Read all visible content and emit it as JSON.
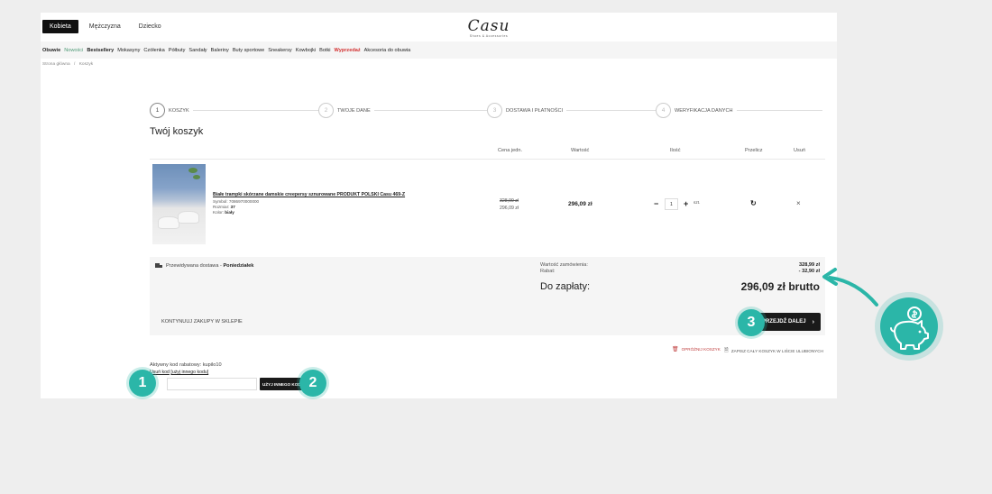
{
  "header": {
    "gender_tabs": [
      "Kobieta",
      "Mężczyzna",
      "Dziecko"
    ],
    "logo": "Casu",
    "logo_sub": "Shoes & Accessories"
  },
  "menu": [
    "Obuwie",
    "Nowości",
    "Bestsellery",
    "Mokasyny",
    "Czółenka",
    "Półbuty",
    "Sandały",
    "Baleriny",
    "Buty sportowe",
    "Sneakersy",
    "Kowbojki",
    "Botki",
    "Wyprzedaż",
    "Akcesoria do obuwia"
  ],
  "breadcrumb": [
    "Strona główna",
    "/",
    "Koszyk"
  ],
  "steps": [
    {
      "num": "1",
      "label": "Koszyk"
    },
    {
      "num": "2",
      "label": "Twoje dane"
    },
    {
      "num": "3",
      "label": "Dostawa i płatności"
    },
    {
      "num": "4",
      "label": "Weryfikacja danych"
    }
  ],
  "cart_title": "Twój koszyk",
  "table_headers": {
    "unit_price": "Cena jedn.",
    "value": "Wartość",
    "qty": "Ilość",
    "recalc": "Przelicz",
    "remove": "Usuń"
  },
  "product": {
    "name": "Białe trampki skórzane damskie creepersy sznurowane PRODUKT POLSKI Casu 469-Z",
    "symbol_label": "Symbol:",
    "symbol": "7086970000000",
    "size_label": "Rozmiar:",
    "size": "37",
    "color_label": "Kolor:",
    "color": "biały",
    "price_old": "328,99 zł",
    "price_new": "296,09 zł",
    "value": "296,09 zł",
    "qty": "1",
    "unit": "szt.",
    "minus": "−",
    "plus": "+",
    "recalc_icon": "↻",
    "remove_icon": "×"
  },
  "summary": {
    "delivery_label": "Przewidywana dostawa - ",
    "delivery_day": "Poniedziałek",
    "order_value_label": "Wartość zamówienia:",
    "order_value": "328,99 zł",
    "discount_label": "Rabat:",
    "discount": "- 32,90 zł",
    "to_pay_label": "Do zapłaty:",
    "to_pay": "296,09 zł brutto",
    "continue": "Kontynuuj zakupy w sklepie",
    "next": "Przejdź dalej",
    "next_chevron": "›"
  },
  "actions": {
    "empty_cart": "Opróżnij koszyk",
    "save_cart": "Zapisz cały koszyk w liście ulubionych"
  },
  "discount_code": {
    "active_label": "Aktywny kod rabatowy: kupilo10",
    "remove_link": "Usuń kod",
    "use_other_link": "[użyj innego kodu]",
    "apply_button": "Użyj innego kodu"
  },
  "callouts": [
    "1",
    "2",
    "3"
  ],
  "colors": {
    "accent": "#2bb6a8",
    "dark": "#1a1a1a",
    "sale": "#d23030",
    "new": "#4e9a76"
  }
}
